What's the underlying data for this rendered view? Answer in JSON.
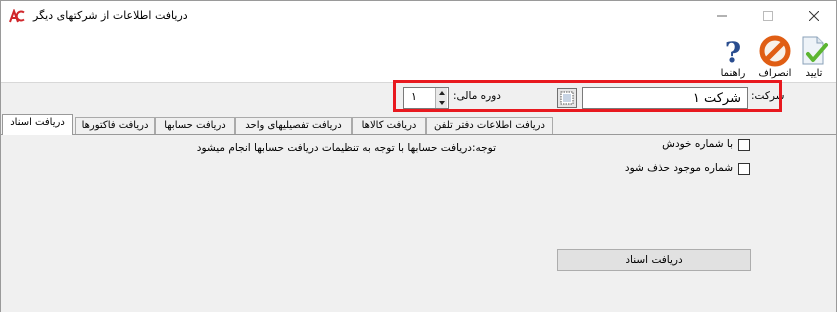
{
  "window": {
    "title": "دريافت اطلاعات از شرکتهای دیگر"
  },
  "toolbar": {
    "confirm_label": "تایید",
    "cancel_label": "انصراف",
    "help_label": "راهنما"
  },
  "filters": {
    "company_label": "شرکت:",
    "company_value": "شرکت ۱",
    "period_label": "دوره مالی:",
    "period_value": "۱"
  },
  "tabs": [
    {
      "label": "دریافت اسناد",
      "active": true
    },
    {
      "label": "دریافت فاکتورها",
      "active": false
    },
    {
      "label": "دریافت حسابها",
      "active": false
    },
    {
      "label": "دریافت تفصیلیهای واحد",
      "active": false
    },
    {
      "label": "دریافت کالاها",
      "active": false
    },
    {
      "label": "دریافت اطلاعات دفتر تلفن",
      "active": false
    }
  ],
  "content": {
    "same_number_label": "با شماره خودش",
    "same_number_checked": false,
    "delete_existing_label": "شماره موجود حذف شود",
    "delete_existing_checked": false,
    "note": "توجه:دریافت حسابها با توجه به تنظیمات دریافت حسابها انجام میشود",
    "submit_label": "دریافت اسناد"
  },
  "colors": {
    "highlight": "#e8191f",
    "window_bg": "#f0f0f0"
  }
}
